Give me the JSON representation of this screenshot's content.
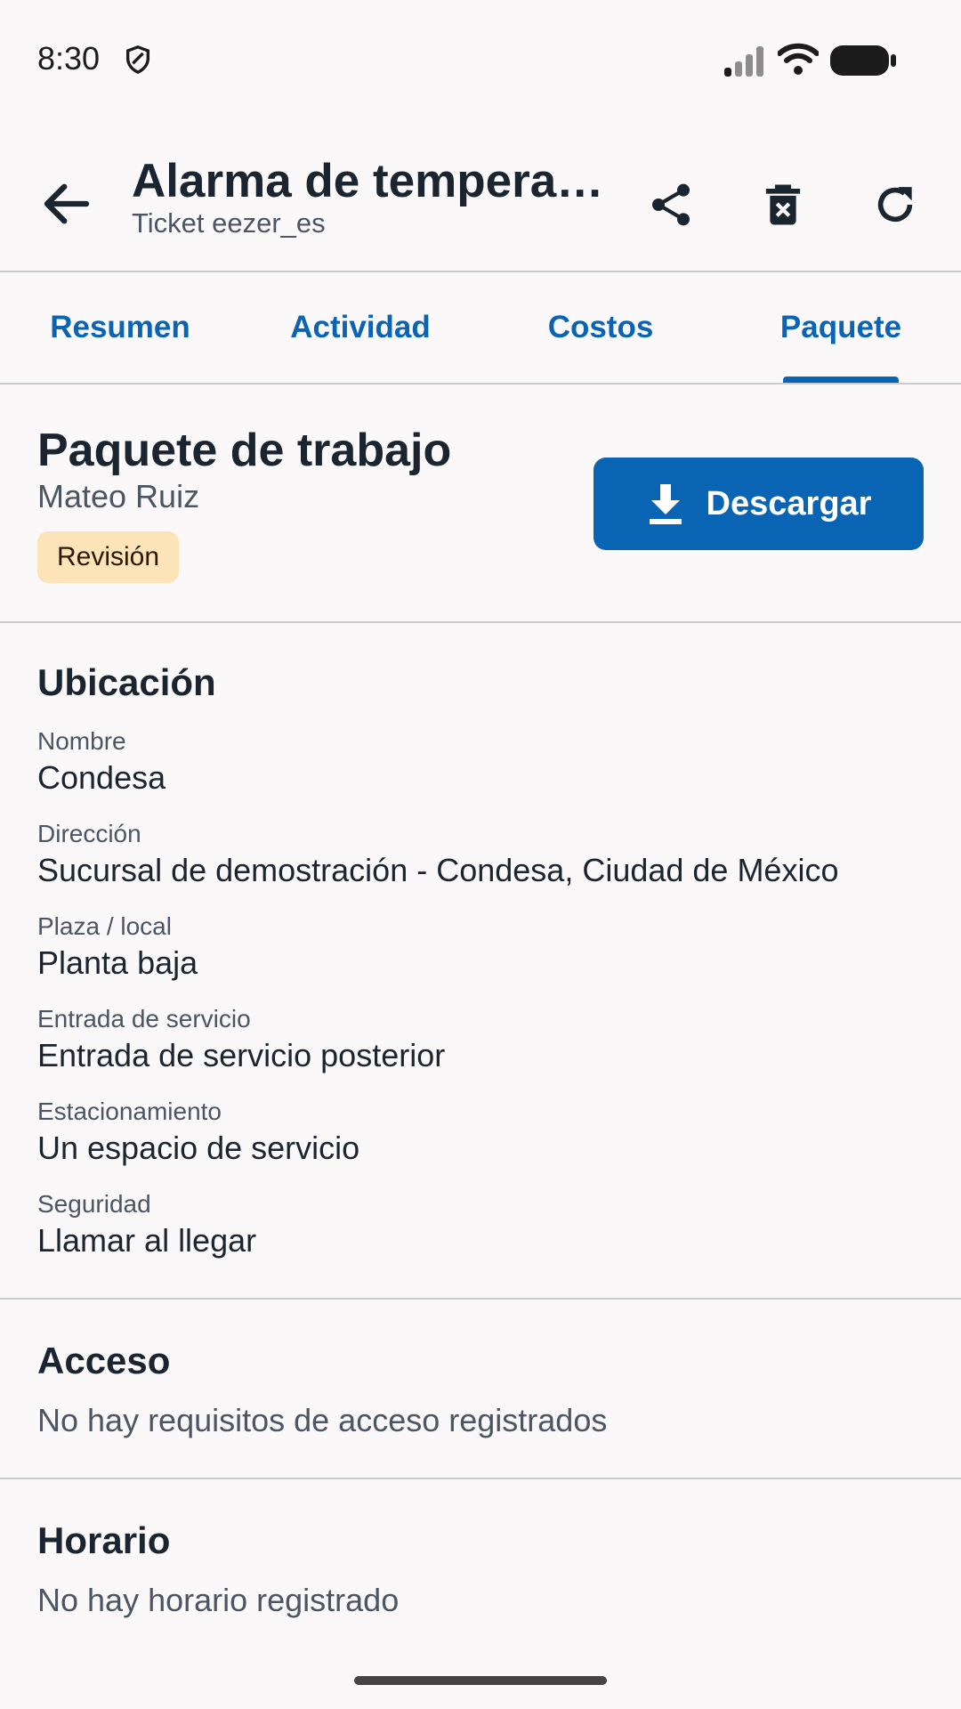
{
  "status_bar": {
    "time": "8:30",
    "icons": [
      "shield-icon",
      "signal-icon",
      "wifi-icon",
      "battery-icon"
    ]
  },
  "app_bar": {
    "title": "Alarma de temperatura",
    "subtitle": "Ticket eezer_es",
    "actions": [
      "share-icon",
      "delete-icon",
      "refresh-icon"
    ]
  },
  "tabs": {
    "items": [
      {
        "label": "Resumen"
      },
      {
        "label": "Actividad"
      },
      {
        "label": "Costos"
      },
      {
        "label": "Paquete"
      }
    ],
    "selected": "Paquete"
  },
  "package": {
    "title": "Paquete de trabajo",
    "owner": "Mateo Ruiz",
    "status": "Revisión",
    "download_label": "Descargar"
  },
  "location": {
    "title": "Ubicación",
    "fields": [
      {
        "label": "Nombre",
        "value": "Condesa"
      },
      {
        "label": "Dirección",
        "value": "Sucursal de demostración - Condesa, Ciudad de México"
      },
      {
        "label": "Plaza / local",
        "value": "Planta baja"
      },
      {
        "label": "Entrada de servicio",
        "value": "Entrada de servicio posterior"
      },
      {
        "label": "Estacionamiento",
        "value": "Un espacio de servicio"
      },
      {
        "label": "Seguridad",
        "value": "Llamar al llegar"
      }
    ]
  },
  "access": {
    "title": "Acceso",
    "text": "No hay requisitos de acceso registrados"
  },
  "schedule": {
    "title": "Horario",
    "text": "No hay horario registrado"
  },
  "colors": {
    "accent": "#0a64b4",
    "badge_bg": "#fde3b8",
    "background": "#fbf8fa"
  }
}
